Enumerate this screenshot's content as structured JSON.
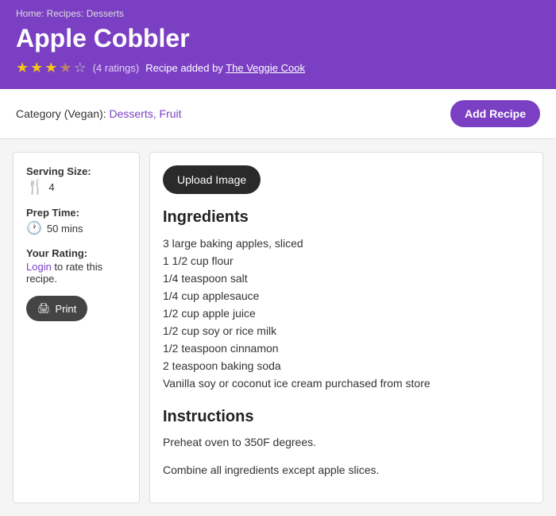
{
  "breadcrumb": "Home: Recipes: Desserts",
  "recipe": {
    "title": "Apple Cobbler",
    "rating": {
      "filled_stars": 3,
      "half_star": true,
      "total_stars": 5,
      "count_text": "(4 ratings)"
    },
    "added_by_prefix": "Recipe added by",
    "added_by_name": "The Veggie Cook"
  },
  "category": {
    "label": "Category (Vegan):",
    "links": "Desserts, Fruit"
  },
  "toolbar": {
    "add_recipe_label": "Add Recipe"
  },
  "sidebar": {
    "serving_size_label": "Serving Size:",
    "serving_size_value": "4",
    "prep_time_label": "Prep Time:",
    "prep_time_value": "50 mins",
    "your_rating_label": "Your Rating:",
    "login_text": "Login",
    "login_suffix": " to rate this recipe.",
    "print_label": "Print"
  },
  "upload_button": "Upload Image",
  "ingredients": {
    "title": "Ingredients",
    "items": [
      "3 large baking apples, sliced",
      "1 1/2 cup flour",
      "1/4 teaspoon salt",
      "1/4 cup applesauce",
      "1/2 cup apple juice",
      "1/2 cup soy or rice milk",
      "1/2 teaspoon cinnamon",
      "2 teaspoon baking soda",
      "Vanilla soy or coconut ice cream purchased from store"
    ]
  },
  "instructions": {
    "title": "Instructions",
    "steps": [
      "Preheat oven to 350F degrees.",
      "Combine all ingredients except apple slices."
    ]
  }
}
